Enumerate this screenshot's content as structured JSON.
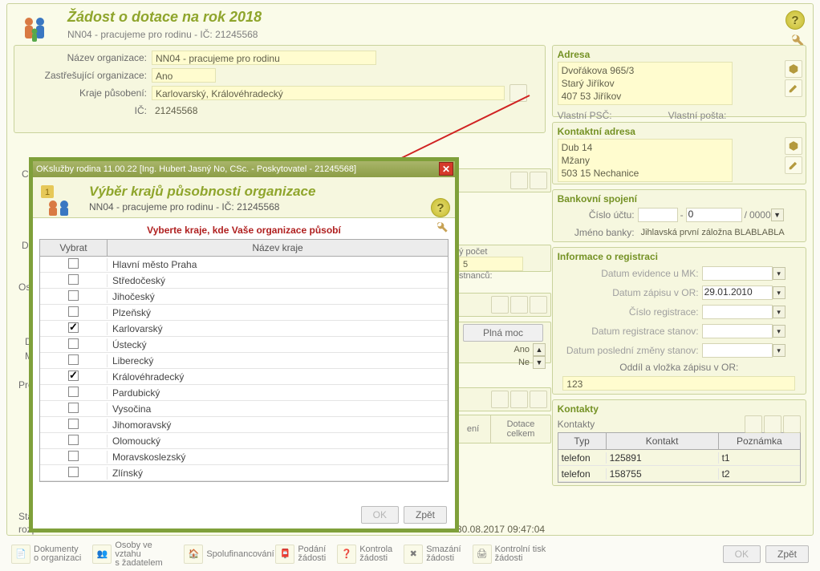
{
  "header": {
    "title": "Žádost o dotace na rok 2018",
    "subtitle": "NN04 - pracujeme pro rodinu - IČ: 21245568"
  },
  "left": {
    "lbl_org": "Název organizace:",
    "val_org": "NN04 - pracujeme pro rodinu",
    "lbl_umbrella": "Zastřešující organizace:",
    "val_umbrella": "Ano",
    "lbl_region": "Kraje působení:",
    "val_region": "Karlovarský, Královéhradecký",
    "lbl_ic": "IČ:",
    "val_ic": "21245568",
    "lbl_char": "Char",
    "lbl_dalsi": "Další",
    "emp_lbl": "ý počet",
    "emp_lbl2": "stnanců:",
    "emp_val": "5",
    "lbl_oso": "Oso",
    "lbl_d": "D",
    "lbl_m": "M",
    "lbl_proj": "Proj",
    "lbl_plna_moc": "Plná moc",
    "ano": "Ano",
    "ne": "Ne",
    "col_eni": "ení",
    "col_dotace": "Dotace\ncelkem",
    "lbl_stav": "Stav",
    "lbl_rozp": "rozp",
    "timestamp": "30.08.2017 09:47:04"
  },
  "right": {
    "adresa_title": "Adresa",
    "adresa_lines": [
      "Dvořákova 965/3",
      "Starý Jiříkov",
      "407 53 Jiříkov"
    ],
    "vlastni_psc_lbl": "Vlastní PSČ:",
    "vlastni_posta_lbl": "Vlastní pošta:",
    "kontakt_adresa_title": "Kontaktní adresa",
    "kadr_lines": [
      "Dub 14",
      "Mžany",
      "503 15 Nechanice"
    ],
    "bank_title": "Bankovní spojení",
    "cislo_uctu_lbl": "Číslo účtu:",
    "cislo_uctu_sep": "-",
    "cislo_uctu_mid": "0",
    "cislo_uctu_slash": "/",
    "cislo_uctu_code": "0000",
    "jmeno_banky_lbl": "Jméno banky:",
    "jmeno_banky_val": "Jihlavská první záložna BLABLABLA",
    "registrace_title": "Informace o registraci",
    "reg_rows": [
      {
        "lbl": "Datum evidence u MK:",
        "val": ""
      },
      {
        "lbl": "Datum zápisu v OR:",
        "val": "29.01.2010"
      },
      {
        "lbl": "Číslo registrace:",
        "val": ""
      },
      {
        "lbl": "Datum registrace stanov:",
        "val": ""
      },
      {
        "lbl": "Datum poslední změny stanov:",
        "val": ""
      }
    ],
    "oddil_lbl": "Oddíl a vložka zápisu v OR:",
    "oddil_val": "123",
    "kontakty_title": "Kontakty",
    "kontakty_sub": "Kontakty",
    "k_headers": [
      "Typ",
      "Kontakt",
      "Poznámka"
    ],
    "k_rows": [
      {
        "typ": "telefon",
        "kontakt": "125891",
        "pozn": "t1"
      },
      {
        "typ": "telefon",
        "kontakt": "158755",
        "pozn": "t2"
      }
    ]
  },
  "dialog": {
    "titlebar": "OKslužby rodina 11.00.22  [Ing. Hubert Jasný No, CSc. - Poskytovatel - 21245568]",
    "title": "Výběr krajů působnosti organizace",
    "subtitle": "NN04 - pracujeme pro rodinu - IČ: 21245568",
    "instruction": "Vyberte kraje, kde Vaše organizace působí",
    "col_select": "Vybrat",
    "col_name": "Název kraje",
    "rows": [
      {
        "name": "Hlavní město Praha",
        "checked": false
      },
      {
        "name": "Středočeský",
        "checked": false
      },
      {
        "name": "Jihočeský",
        "checked": false
      },
      {
        "name": "Plzeňský",
        "checked": false
      },
      {
        "name": "Karlovarský",
        "checked": true
      },
      {
        "name": "Ústecký",
        "checked": false
      },
      {
        "name": "Liberecký",
        "checked": false
      },
      {
        "name": "Královéhradecký",
        "checked": true
      },
      {
        "name": "Pardubický",
        "checked": false
      },
      {
        "name": "Vysočina",
        "checked": false
      },
      {
        "name": "Jihomoravský",
        "checked": false
      },
      {
        "name": "Olomoucký",
        "checked": false
      },
      {
        "name": "Moravskoslezský",
        "checked": false
      },
      {
        "name": "Zlínský",
        "checked": false
      }
    ],
    "ok": "OK",
    "zpet": "Zpět"
  },
  "toolbar": {
    "items": [
      {
        "l1": "Dokumenty",
        "l2": "o organizaci"
      },
      {
        "l1": "Osoby ve vztahu",
        "l2": "s žadatelem"
      },
      {
        "l1": "Spolufinancování",
        "l2": ""
      },
      {
        "l1": "Podání",
        "l2": "žádosti"
      },
      {
        "l1": "Kontrola",
        "l2": "žádosti"
      },
      {
        "l1": "Smazání",
        "l2": "žádosti"
      },
      {
        "l1": "Kontrolní tisk",
        "l2": "žádosti"
      }
    ],
    "ok": "OK",
    "zpet": "Zpět"
  }
}
